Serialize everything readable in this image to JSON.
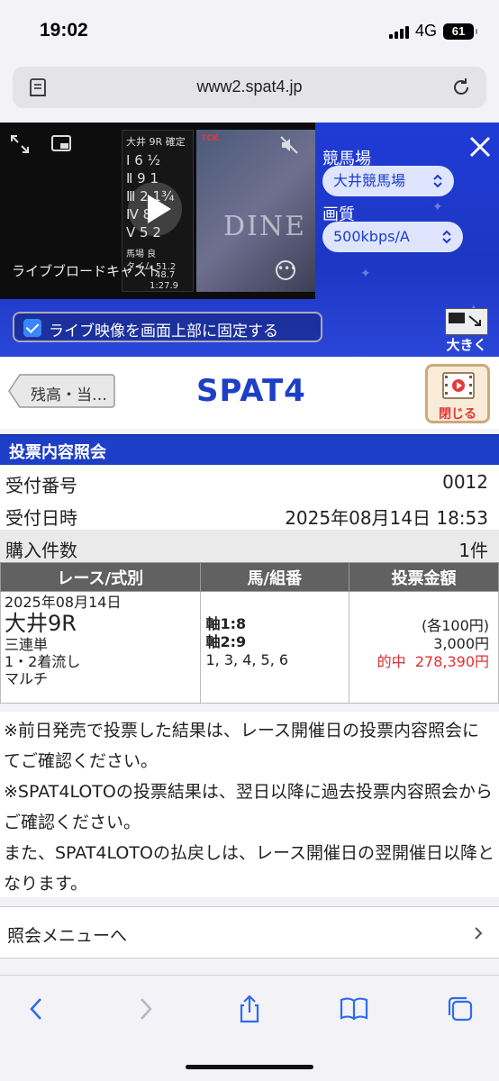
{
  "status": {
    "time": "19:02",
    "network": "4G",
    "battery": "61"
  },
  "browser": {
    "url": "www2.spat4.jp"
  },
  "player": {
    "title": "ライブブロードキャスト",
    "board_lines": [
      "大井 9R 確定",
      "Ⅰ 6 ½",
      "Ⅱ 9 1",
      "Ⅲ 2 1¾",
      "Ⅳ 8",
      "Ⅴ 5 2",
      "馬場 良",
      "タイム 51.2",
      "48.7",
      "1:27.9"
    ],
    "screen_text": "DINE",
    "broadcaster": "TCK"
  },
  "controls": {
    "venue_label": "競馬場",
    "venue_value": "大井競馬場",
    "quality_label": "画質",
    "quality_value": "500kbps/A",
    "pin_label": "ライブ映像を画面上部に固定する",
    "pin_checked": true,
    "enlarge_label": "大きく"
  },
  "header": {
    "back_label": "残高・当…",
    "logo": "SPAT4",
    "close_label": "閉じる"
  },
  "section_title": "投票内容照会",
  "info": [
    {
      "key": "受付番号",
      "value": "0012"
    },
    {
      "key": "受付日時",
      "value": "2025年08月14日 18:53"
    },
    {
      "key": "購入件数",
      "value": "1件"
    }
  ],
  "table": {
    "headers": [
      "レース/式別",
      "馬/組番",
      "投票金額"
    ],
    "row": {
      "date": "2025年08月14日",
      "race": "大井9R",
      "bet_type": "三連単",
      "method": "1・2着流し",
      "option": "マルチ",
      "axis1": "軸1:8",
      "axis2": "軸2:9",
      "partners": "1, 3, 4, 5, 6",
      "unit": "(各100円)",
      "amount": "3,000円",
      "hit_label": "的中",
      "payout": "278,390円"
    }
  },
  "notes": [
    "※前日発売で投票した結果は、レース開催日の投票内容照会にてご確認ください。",
    "※SPAT4LOTOの投票結果は、翌日以降に過去投票内容照会からご確認ください。",
    "また、SPAT4LOTOの払戻しは、レース開催日の翌開催日以降となります。"
  ],
  "menu_link": "照会メニューへ",
  "colors": {
    "brand": "#1d3fc8",
    "hit": "#e03030",
    "header_gray": "#616161"
  },
  "toolbar_icons": [
    "back-icon",
    "forward-icon",
    "share-icon",
    "bookmarks-icon",
    "tabs-icon"
  ]
}
